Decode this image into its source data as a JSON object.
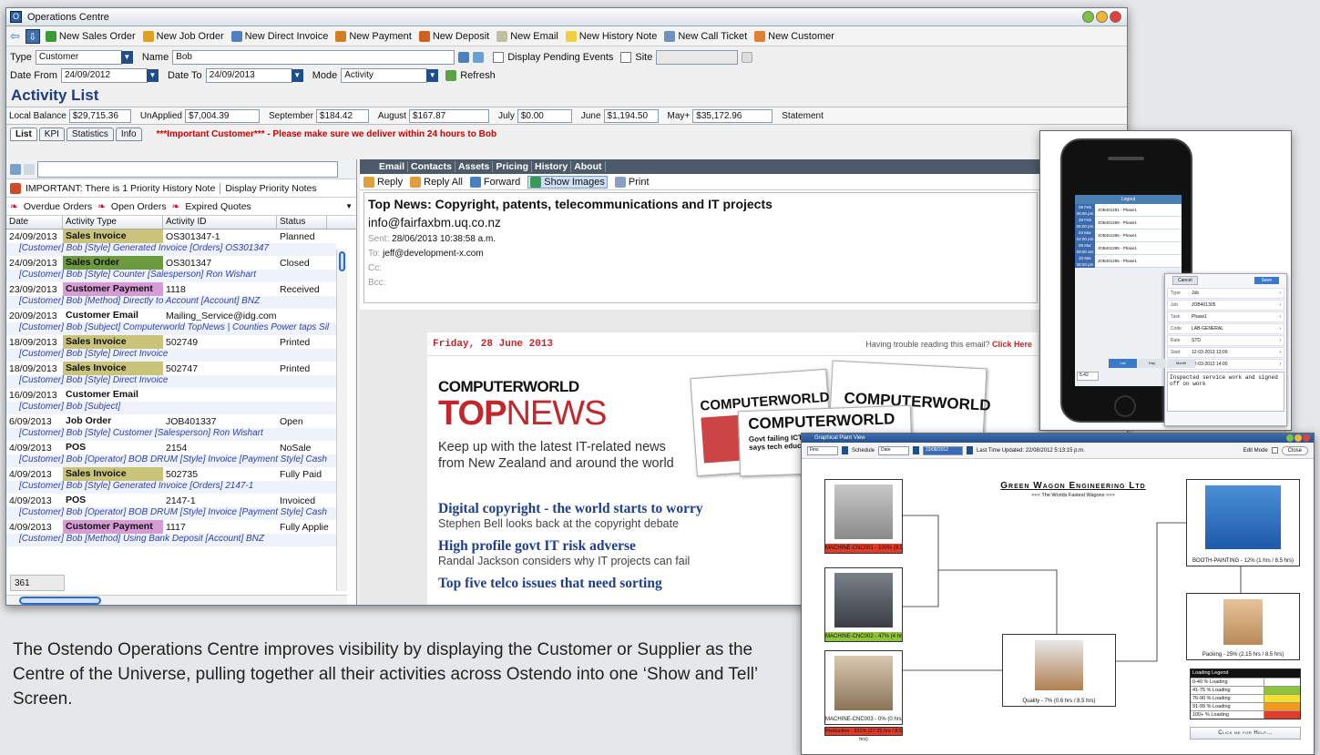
{
  "window": {
    "title": "Operations Centre"
  },
  "toolbar": [
    {
      "icon": "sales-order-icon",
      "label": "New Sales Order",
      "color": "#3a9a3a"
    },
    {
      "icon": "job-order-icon",
      "label": "New Job Order",
      "color": "#e0a020"
    },
    {
      "icon": "invoice-icon",
      "label": "New Direct Invoice",
      "color": "#5080c0"
    },
    {
      "icon": "payment-icon",
      "label": "New Payment",
      "color": "#d08020"
    },
    {
      "icon": "deposit-icon",
      "label": "New Deposit",
      "color": "#d06020"
    },
    {
      "icon": "email-icon",
      "label": "New Email",
      "color": "#c0c0a0"
    },
    {
      "icon": "history-note-icon",
      "label": "New History Note",
      "color": "#f0d040"
    },
    {
      "icon": "call-ticket-icon",
      "label": "New Call Ticket",
      "color": "#7090c0"
    },
    {
      "icon": "customer-icon",
      "label": "New Customer",
      "color": "#e08030"
    }
  ],
  "filters": {
    "type_label": "Type",
    "type_value": "Customer",
    "name_label": "Name",
    "name_value": "Bob",
    "pending_label": "Display Pending Events",
    "site_label": "Site",
    "date_from_label": "Date From",
    "date_from": "24/09/2012",
    "date_to_label": "Date To",
    "date_to": "24/09/2013",
    "mode_label": "Mode",
    "mode_value": "Activity",
    "refresh_label": "Refresh"
  },
  "activity_title": "Activity List",
  "balances": [
    {
      "label": "Local Balance",
      "value": "$29,715.36"
    },
    {
      "label": "UnApplied",
      "value": "$7,004.39"
    },
    {
      "label": "September",
      "value": "$184.42"
    },
    {
      "label": "August",
      "value": "$167.87"
    },
    {
      "label": "July",
      "value": "$0.00"
    },
    {
      "label": "June",
      "value": "$1,194.50"
    },
    {
      "label": "May+",
      "value": "$35,172.96"
    }
  ],
  "statement_label": "Statement",
  "tabs": [
    "List",
    "KPI",
    "Statistics",
    "Info"
  ],
  "warning": "***Important Customer*** -  Please make sure we deliver within 24 hours to Bob",
  "left": {
    "priority_note": "IMPORTANT: There is 1 Priority History Note",
    "display_priority": "Display Priority Notes",
    "overdue": "Overdue Orders",
    "open": "Open Orders",
    "expired": "Expired Quotes",
    "columns": [
      "Date",
      "Activity Type",
      "Activity ID",
      "Status"
    ],
    "rows": [
      {
        "date": "24/09/2013",
        "type": "Sales Invoice",
        "color": "#c9c47a",
        "id": "OS301347-1",
        "status": "Planned",
        "sub": "[Customer] Bob [Style] Generated Invoice [Orders] OS301347"
      },
      {
        "date": "24/09/2013",
        "type": "Sales Order",
        "color": "#6c9a3e",
        "id": "OS301347",
        "status": "Closed",
        "sub": "[Customer] Bob [Style] Counter [Salesperson] Ron Wishart"
      },
      {
        "date": "23/09/2013",
        "type": "Customer Payment",
        "color": "#d79bd6",
        "id": "1118",
        "status": "Received",
        "sub": "[Customer] Bob [Method] Directly to Account [Account] BNZ"
      },
      {
        "date": "20/09/2013",
        "type": "Customer Email",
        "color": "",
        "id": "Mailing_Service@idg.com....",
        "status": "",
        "sub": "[Customer] Bob [Subject] Computerworld TopNews | Counties Power taps Sil"
      },
      {
        "date": "18/09/2013",
        "type": "Sales Invoice",
        "color": "#c9c47a",
        "id": "502749",
        "status": "Printed",
        "sub": "[Customer] Bob [Style] Direct Invoice"
      },
      {
        "date": "18/09/2013",
        "type": "Sales Invoice",
        "color": "#c9c47a",
        "id": "502747",
        "status": "Printed",
        "sub": "[Customer] Bob [Style] Direct Invoice"
      },
      {
        "date": "16/09/2013",
        "type": "Customer Email",
        "color": "",
        "id": "",
        "status": "",
        "sub": "[Customer] Bob [Subject]"
      },
      {
        "date": "6/09/2013",
        "type": "Job Order",
        "color": "",
        "id": "JOB401337",
        "status": "Open",
        "sub": "[Customer] Bob [Style] Customer [Salesperson] Ron Wishart"
      },
      {
        "date": "4/09/2013",
        "type": "POS",
        "color": "",
        "id": "2154",
        "status": "NoSale",
        "sub": "[Customer] Bob [Operator] BOB DRUM [Style] Invoice [Payment Style] Cash"
      },
      {
        "date": "4/09/2013",
        "type": "Sales Invoice",
        "color": "#c9c47a",
        "id": "502735",
        "status": "Fully Paid",
        "sub": "[Customer] Bob [Style] Generated Invoice [Orders] 2147-1"
      },
      {
        "date": "4/09/2013",
        "type": "POS",
        "color": "",
        "id": "2147-1",
        "status": "Invoiced",
        "sub": "[Customer] Bob [Operator] BOB DRUM [Style] Invoice [Payment Style] Cash"
      },
      {
        "date": "4/09/2013",
        "type": "Customer Payment",
        "color": "#d79bd6",
        "id": "1117",
        "status": "Fully Applie",
        "sub": "[Customer] Bob [Method] Using Bank Deposit [Account] BNZ"
      }
    ],
    "count": "361"
  },
  "email": {
    "tabs": [
      "Email",
      "Contacts",
      "Assets",
      "Pricing",
      "History",
      "About"
    ],
    "actions": [
      "Reply",
      "Reply All",
      "Forward",
      "Show Images",
      "Print"
    ],
    "subject": "Top News: Copyright, patents, telecommunications and IT projects",
    "from": "info@fairfaxbm.uq.co.nz",
    "sent_label": "Sent:",
    "sent": "28/06/2013 10:38:58 a.m.",
    "to_label": "To:",
    "to": "jeff@development-x.com",
    "cc_label": "Cc:",
    "bcc_label": "Bcc:"
  },
  "newsletter": {
    "date": "Friday, 28 June 2013",
    "trouble": "Having trouble reading this email?",
    "click": "Click Here",
    "brand": "COMPUTERWORLD",
    "top": "TOP",
    "news": "NEWS",
    "tagline1": "Keep up with the latest IT-related news",
    "tagline2": "from New Zealand and around the world",
    "mag1": "COMPUTERWORLD",
    "mag2": "COMPUTERWORLD",
    "mag3": "COMPUTERWORLD",
    "mag_story": "Govt failing ICT teachers says tech educator",
    "stories": [
      {
        "head": "Digital copyright - the world starts to worry",
        "sub": "Stephen Bell looks back at the copyright debate"
      },
      {
        "head": "High profile govt IT risk adverse",
        "sub": "Randal Jackson considers why IT projects can fail"
      },
      {
        "head": "Top five telco issues that need sorting",
        "sub": ""
      }
    ]
  },
  "caption": "The Ostendo Operations Centre improves visibility by displaying the Customer or Supplier as the Centre of the Universe, pulling together all their activities across Ostendo into one ‘Show and Tell’ Screen.",
  "phone": {
    "header": "Logout",
    "jobs": [
      {
        "day": "09 Feb",
        "time": "06:00 pm",
        "job": "JOB401291 - Phase1"
      },
      {
        "day": "28 Feb",
        "time": "06:00 pm",
        "job": "JOB401289 - Phase1"
      },
      {
        "day": "04 Mar",
        "time": "02:00 pm",
        "job": "JOB401295 - Phase1"
      },
      {
        "day": "09 Mar",
        "time": "09:00 am",
        "job": "JOB401295 - Phase1"
      },
      {
        "day": "10 Mar",
        "time": "08:00 pm",
        "job": "JOB401295 - Phase1"
      }
    ],
    "cancel": "Cancel",
    "save": "Save",
    "fields": [
      {
        "k": "Type",
        "v": "Job"
      },
      {
        "k": "Job",
        "v": "JOB401305"
      },
      {
        "k": "Task",
        "v": "Phase1"
      },
      {
        "k": "Code",
        "v": "LAB-GENERAL"
      },
      {
        "k": "Rate",
        "v": "STD"
      },
      {
        "k": "Start",
        "v": "12-03-2013 13:00"
      },
      {
        "k": "End",
        "v": "12-03-2013 14:00"
      }
    ],
    "note": "Inspected service work and signed off on work",
    "qty": "5.42",
    "views": [
      "List",
      "Day",
      "Month"
    ]
  },
  "plant": {
    "title": "Graphical Plant View",
    "filter1": "Fins",
    "sched": "Schedule",
    "datelbl": "Date",
    "datev": "23/08/2012",
    "updated": "Last Time Updated: 22/08/2012 5:13:15 p.m.",
    "edit": "Edit Mode",
    "close": "Close",
    "company": "Green Wagon Engineering Ltd",
    "slogan": "<<< The Worlds Fastest Wagons >>>",
    "machines": [
      {
        "name": "MACHINE-CNC001 - 100% (8.5 hrs / 8.5 hrs)",
        "color": "#e23b2a"
      },
      {
        "name": "MACHINE-CNC002 - 47% (4 hrs / 8.5 hrs)",
        "color": "#8fc43c"
      },
      {
        "name": "MACHINE-CNC003 - 0% (0 hrs / 8.5 hrs)",
        "color": "#ffffff"
      },
      {
        "name": "Production - 321% (27.25 hrs / 8.5 hrs)",
        "color": "#e23b2a"
      },
      {
        "name": "Quality - 7% (0.6 hrs / 8.5 hrs)",
        "color": "#ffffff"
      },
      {
        "name": "BOOTH-PAINTING - 12% (1 hrs / 8.5 hrs)",
        "color": "#ffffff"
      },
      {
        "name": "Packing - 25% (2.15 hrs / 8.5 hrs)",
        "color": "#ffffff"
      }
    ],
    "legend_title": "Loading Legend",
    "legend": [
      {
        "label": "0-40 % Loading",
        "color": "#ffffff"
      },
      {
        "label": "41-75 % Loading",
        "color": "#8fc43c"
      },
      {
        "label": "76-90 % Loading",
        "color": "#f5e02a"
      },
      {
        "label": "91-99 % Loading",
        "color": "#f39a1e"
      },
      {
        "label": "100+ % Loading",
        "color": "#e23b2a"
      }
    ],
    "help": "Click me for Help..."
  }
}
